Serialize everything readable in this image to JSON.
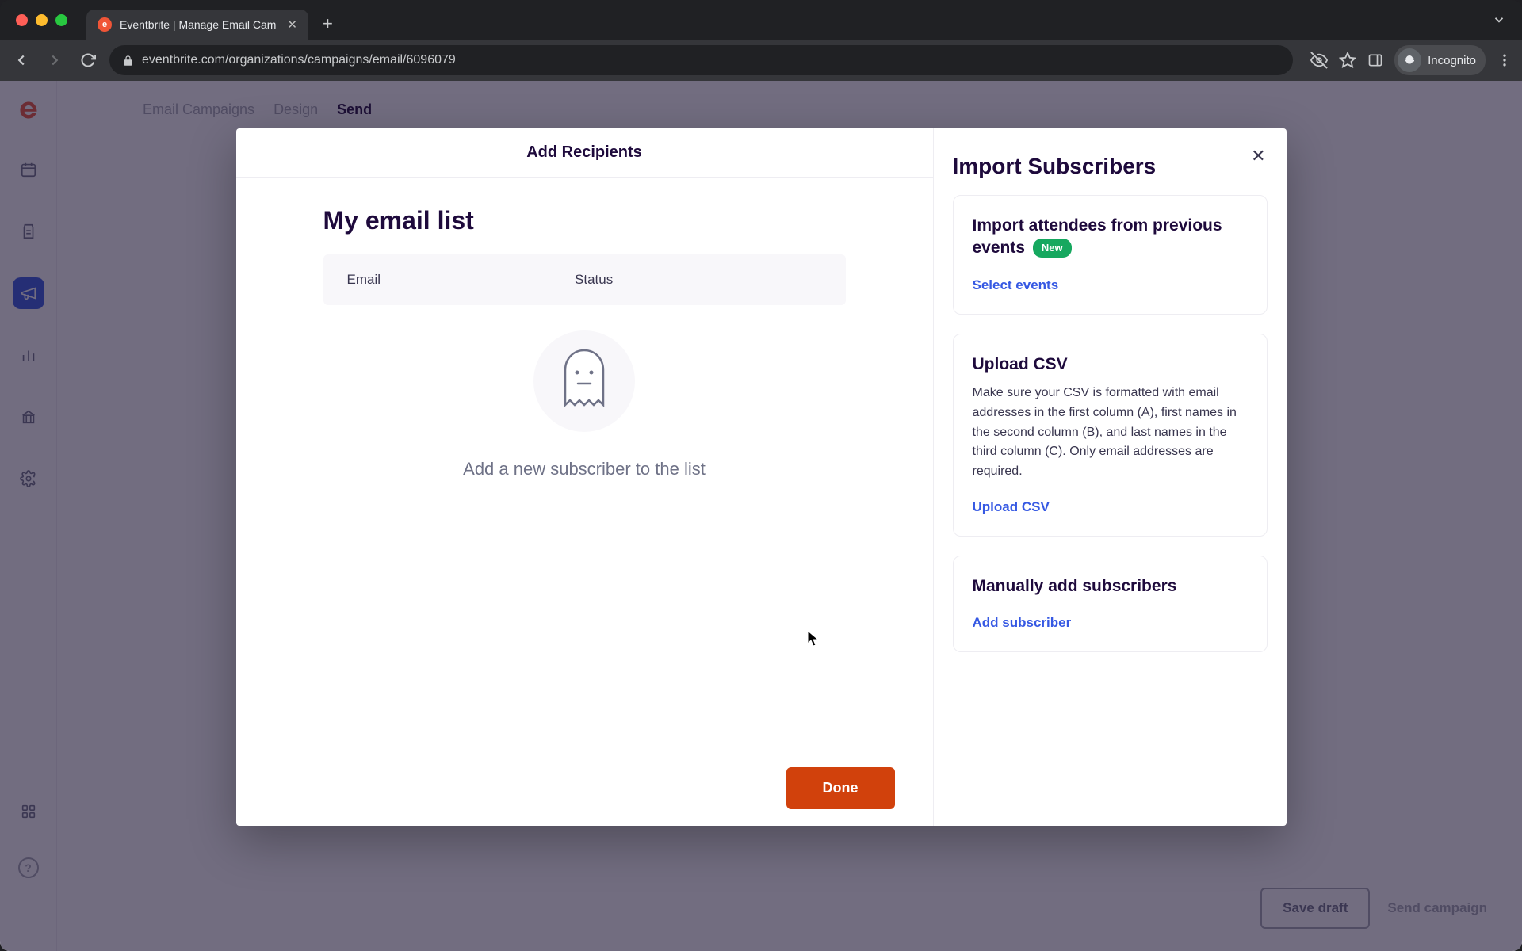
{
  "browser": {
    "tab_title": "Eventbrite | Manage Email Cam",
    "url": "eventbrite.com/organizations/campaigns/email/6096079",
    "incognito_label": "Incognito"
  },
  "breadcrumbs": {
    "items": [
      "Email Campaigns",
      "Design",
      "Send"
    ],
    "active_index": 2
  },
  "page_actions": {
    "save_draft": "Save draft",
    "send_campaign": "Send campaign"
  },
  "modal": {
    "title": "Add Recipients",
    "list_title": "My email list",
    "columns": {
      "email": "Email",
      "status": "Status"
    },
    "empty_message": "Add a new subscriber to the list",
    "done_label": "Done"
  },
  "import_panel": {
    "title": "Import Subscribers",
    "card_prev": {
      "title": "Import attendees from previous events",
      "badge": "New",
      "action": "Select events"
    },
    "card_csv": {
      "title": "Upload CSV",
      "desc": "Make sure your CSV is formatted with email addresses in the first column (A), first names in the second column (B), and last names in the third column (C). Only email addresses are required.",
      "action": "Upload CSV"
    },
    "card_manual": {
      "title": "Manually add subscribers",
      "action": "Add subscriber"
    }
  }
}
